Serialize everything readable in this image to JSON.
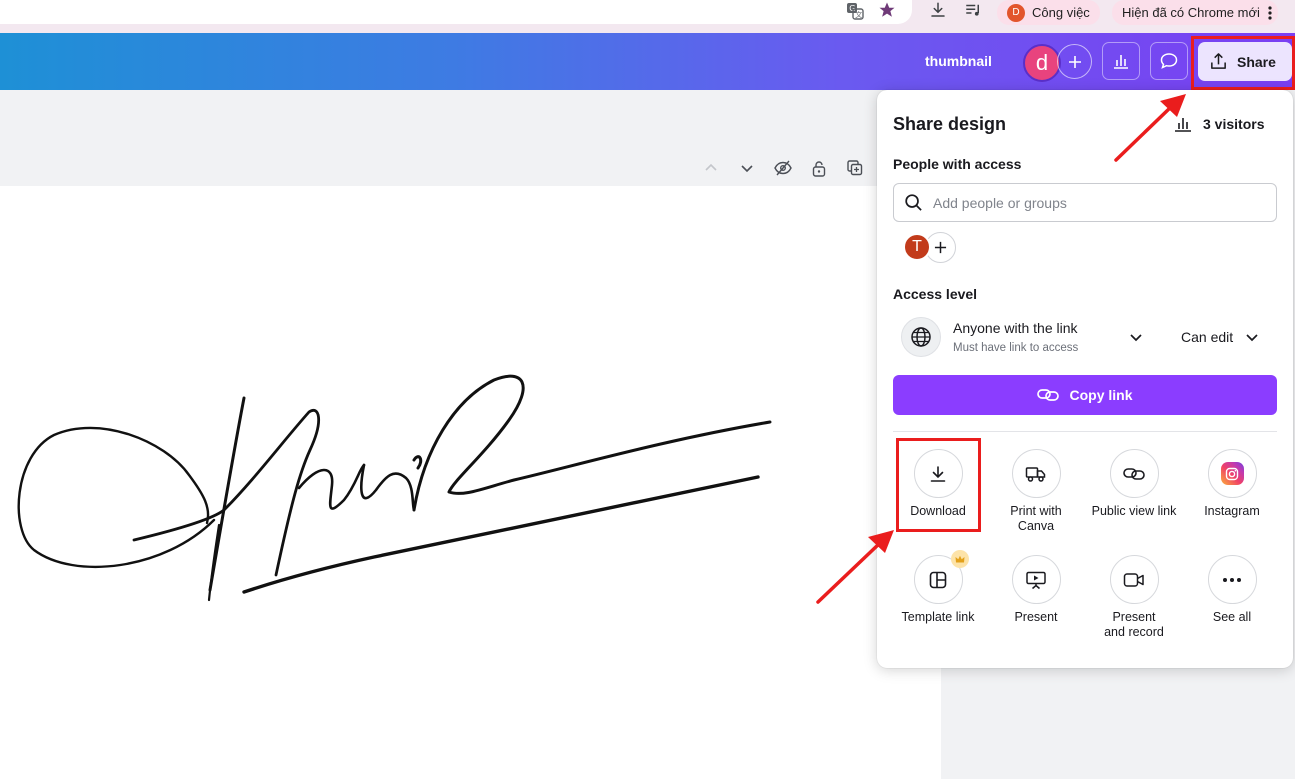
{
  "browser": {
    "profile_initial": "D",
    "profile_label": "Công việc",
    "update_label": "Hiện đã có Chrome mới"
  },
  "header": {
    "doc_title": "thumbnail",
    "user_initial": "d",
    "share_label": "Share"
  },
  "share_panel": {
    "title": "Share design",
    "visitors_label": "3 visitors",
    "people_heading": "People with access",
    "search_placeholder": "Add people or groups",
    "member_initial": "T",
    "access_heading": "Access level",
    "access_option": "Anyone with the link",
    "access_sub": "Must have link to access",
    "permission": "Can edit",
    "copy_link_label": "Copy link",
    "actions": [
      {
        "label": "Download",
        "icon": "download-icon"
      },
      {
        "label": "Print with Canva",
        "icon": "truck-icon"
      },
      {
        "label": "Public view link",
        "icon": "link-icon"
      },
      {
        "label": "Instagram",
        "icon": "instagram-icon"
      },
      {
        "label": "Template link",
        "icon": "template-icon"
      },
      {
        "label": "Present",
        "icon": "present-icon"
      },
      {
        "label": "Present and record",
        "icon": "video-icon"
      },
      {
        "label": "See all",
        "icon": "more-icon"
      }
    ]
  },
  "colors": {
    "accent": "#8b3dff",
    "highlight": "#ea1d1d",
    "avatar_pink": "#e8437e",
    "avatar_red": "#c23b1b"
  }
}
